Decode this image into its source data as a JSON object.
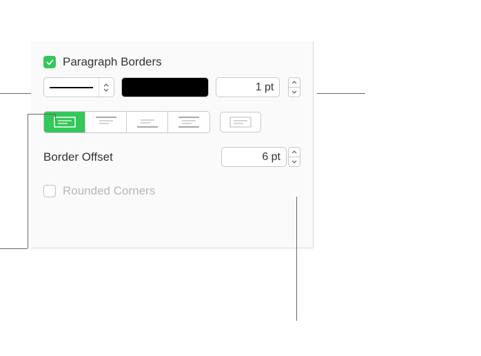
{
  "section": {
    "title": "Paragraph Borders",
    "title_checked": true
  },
  "line_style": {
    "value": "solid"
  },
  "color": {
    "value": "#000000"
  },
  "border_weight": {
    "value": "1 pt"
  },
  "border_positions": {
    "active": "all",
    "options": [
      "all",
      "top",
      "bottom",
      "left",
      "outline"
    ]
  },
  "border_offset": {
    "label": "Border Offset",
    "value": "6 pt"
  },
  "rounded_corners": {
    "label": "Rounded Corners",
    "checked": false
  }
}
